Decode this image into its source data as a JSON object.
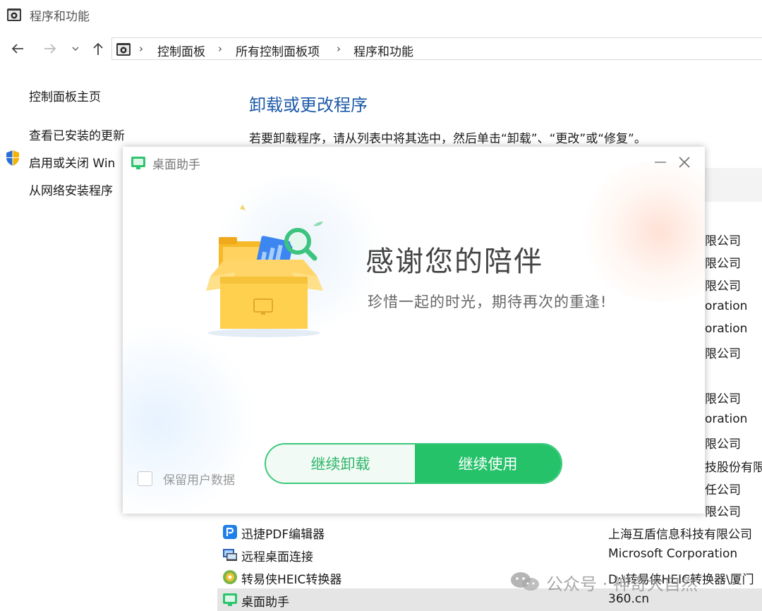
{
  "window": {
    "title": "程序和功能",
    "icon": "control-panel-icon"
  },
  "address": {
    "nav": [
      "back-arrow-icon",
      "forward-arrow-icon",
      "history-dropdown-icon",
      "up-arrow-icon"
    ],
    "crumbs": [
      "控制面板",
      "所有控制面板项",
      "程序和功能"
    ]
  },
  "sidebar": {
    "items": [
      {
        "label": "控制面板主页"
      },
      {
        "label": "查看已安装的更新"
      },
      {
        "label": "启用或关闭 Win",
        "icon": "shield-icon"
      },
      {
        "label": "从网络安装程序"
      }
    ]
  },
  "main": {
    "title": "卸载或更改程序",
    "description": "若要卸载程序，请从列表中将其选中，然后单击“卸载”、“更改”或“修复”。"
  },
  "right_publishers": [
    "限公司",
    "限公司",
    "限公司",
    "oration",
    "oration",
    "限公司",
    "限公司",
    "oration",
    "限公司",
    "技股份有限",
    "任公司",
    "限公司"
  ],
  "programs": [
    {
      "name": "迅捷PDF编辑器",
      "publisher": "上海互盾信息科技有限公司",
      "icon": "pdf-editor-icon"
    },
    {
      "name": "远程桌面连接",
      "publisher": "Microsoft Corporation",
      "icon": "remote-desktop-icon"
    },
    {
      "name": "转易侠HEIC转换器",
      "publisher": "D:\\转易侠HEIC转换器\\厦门",
      "icon": "heic-converter-icon"
    },
    {
      "name": "桌面助手",
      "publisher": "360.cn",
      "icon": "desktop-assistant-icon",
      "selected": true
    }
  ],
  "watermark": {
    "text": "公众号 · 神奇大自然",
    "icon": "wechat-icon"
  },
  "dialog": {
    "title": "桌面助手",
    "headline": "感谢您的陪伴",
    "subline": "珍惜一起的时光，期待再次的重逢!",
    "continue_uninstall": "继续卸载",
    "continue_use": "继续使用",
    "keep_data_label": "保留用户数据",
    "keep_data_checked": false,
    "colors": {
      "accent": "#25c26a",
      "accent_light": "#f1faf4",
      "title_blue": "#1e5aa8"
    }
  }
}
